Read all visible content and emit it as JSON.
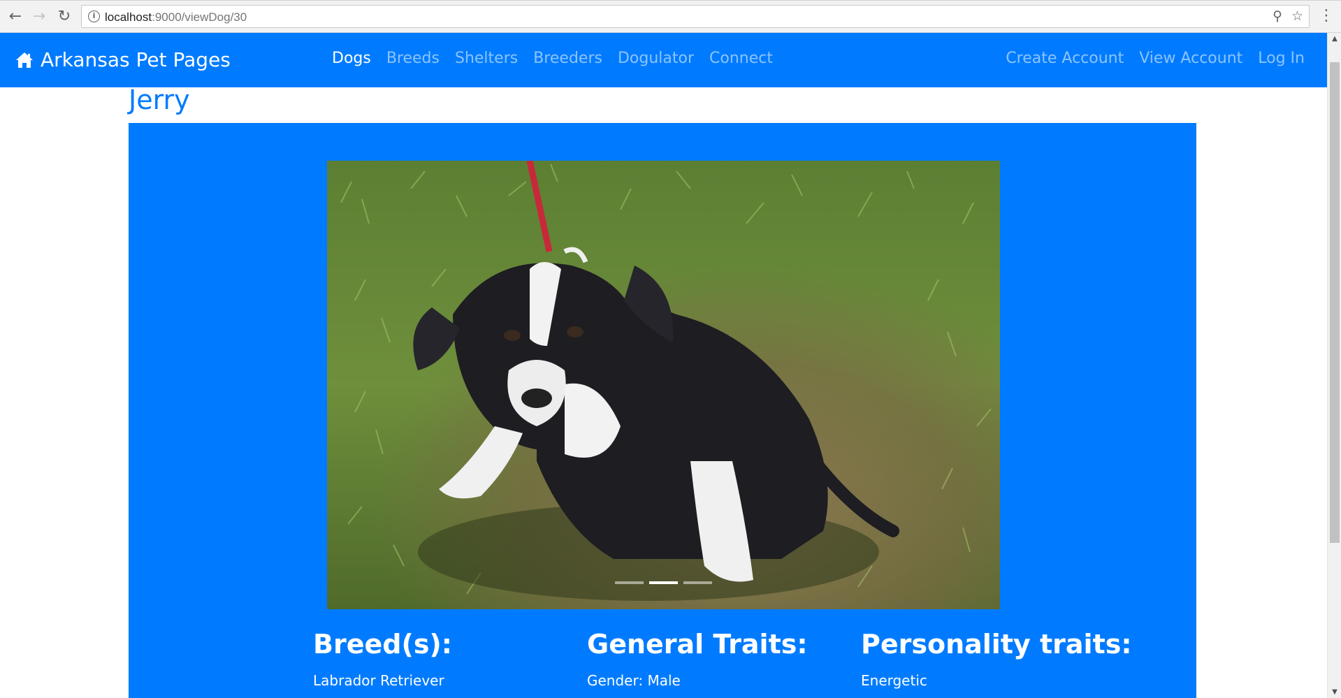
{
  "browser": {
    "url_host": "localhost",
    "url_rest": ":9000/viewDog/30",
    "back_icon": "back-arrow-icon",
    "forward_icon": "forward-arrow-icon",
    "reload_icon": "reload-icon"
  },
  "navbar": {
    "brand": "Arkansas Pet Pages",
    "links": [
      "Dogs",
      "Breeds",
      "Shelters",
      "Breeders",
      "Dogulator",
      "Connect"
    ],
    "right_links": [
      "Create Account",
      "View Account",
      "Log In"
    ],
    "color": "#007bff"
  },
  "dog": {
    "name": "Jerry",
    "carousel": {
      "slides": 3,
      "active_slide": 2
    }
  },
  "sections": {
    "breeds": {
      "heading": "Breed(s):",
      "value": "Labrador Retriever"
    },
    "general": {
      "heading": "General Traits:",
      "value": "Gender: Male"
    },
    "personality": {
      "heading": "Personality traits:",
      "value": "Energetic"
    }
  }
}
